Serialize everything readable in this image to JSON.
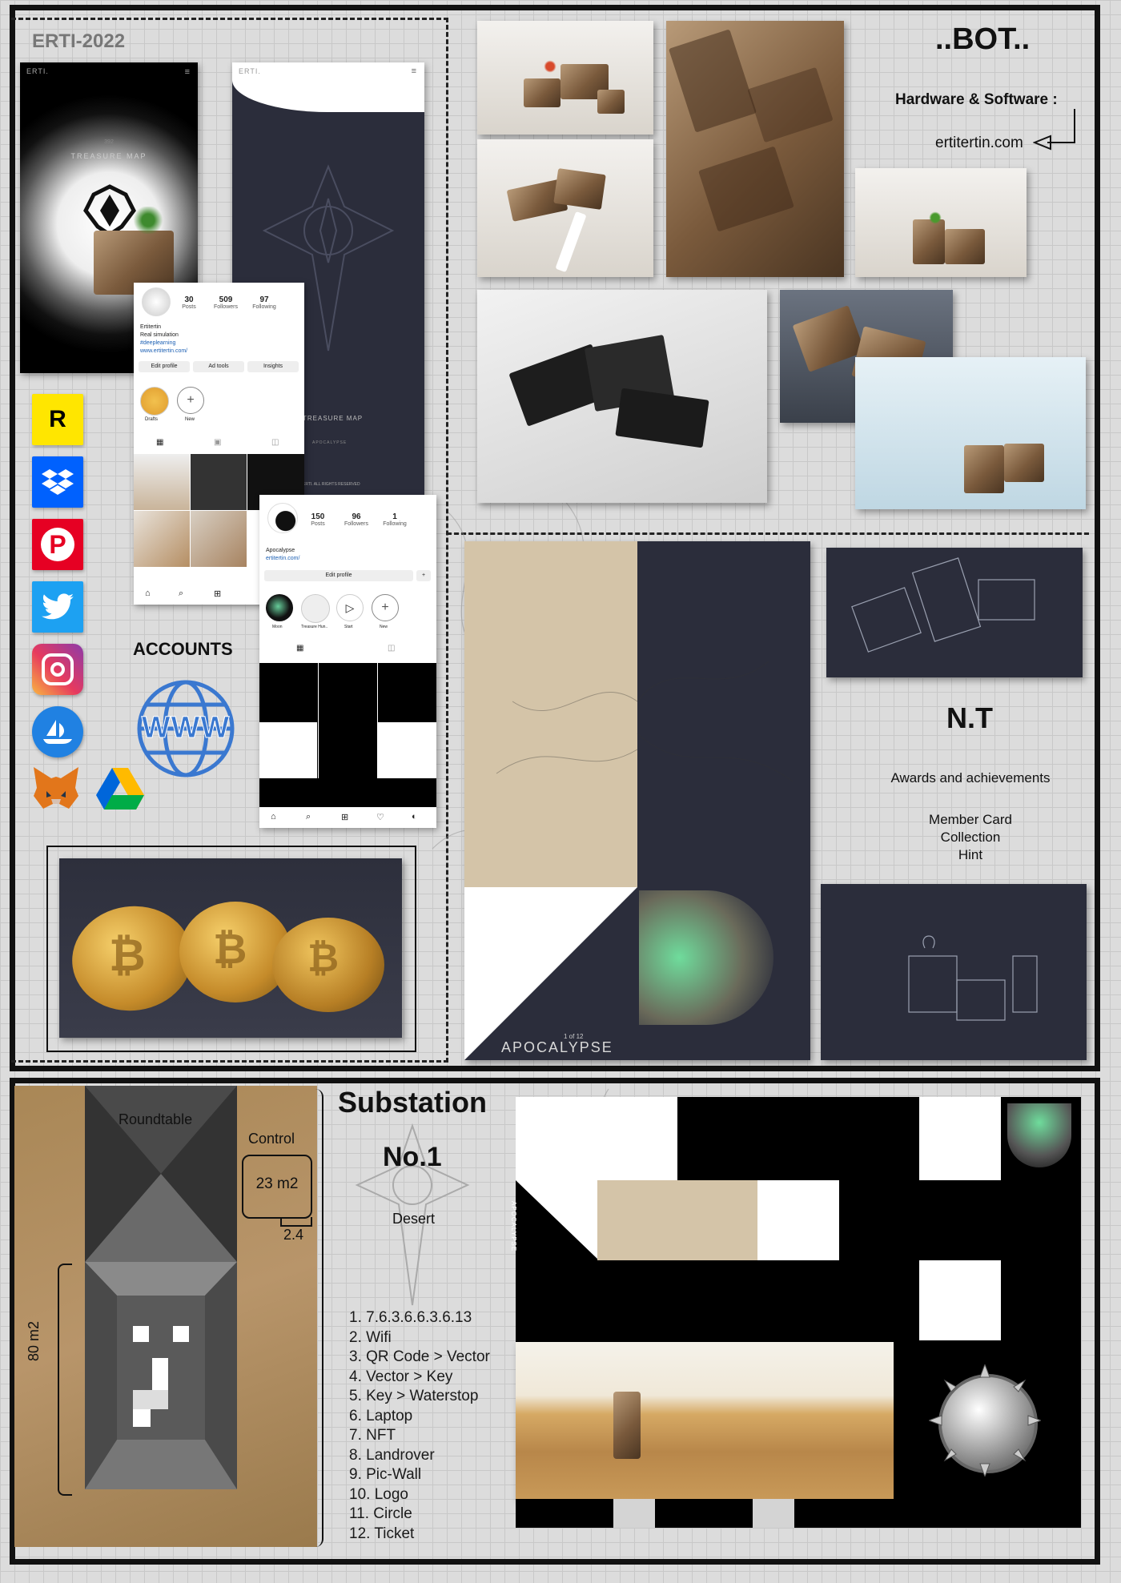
{
  "header": {
    "title": "ERTI-2022"
  },
  "bot": {
    "title": "..BOT..",
    "subtitle": "Hardware & Software :",
    "website": "ertitertin.com"
  },
  "phone1": {
    "brand": "ERTI.",
    "number": "392",
    "caption": "TREASURE MAP"
  },
  "phone2": {
    "brand": "ERTI.",
    "caption": "TREASURE MAP",
    "sub": "APOCALYPSE",
    "footer": "ERTI. ALL RIGHTS RESERVED"
  },
  "profile1": {
    "posts": "30",
    "posts_label": "Posts",
    "followers": "509",
    "followers_label": "Followers",
    "following": "97",
    "following_label": "Following",
    "name": "Ertitertin",
    "bio": "Real simulation",
    "tag": "#deeplearning",
    "link": "www.ertitertin.com/",
    "btn1": "Edit profile",
    "btn2": "Ad tools",
    "btn3": "Insights",
    "highlight1": "Drafts",
    "highlight2": "New"
  },
  "profile2": {
    "posts": "150",
    "posts_label": "Posts",
    "followers": "96",
    "followers_label": "Followers",
    "following": "1",
    "following_label": "Following",
    "name": "Apocalypse",
    "link": "ertitertin.com/",
    "btn": "Edit profile",
    "h1": "Moon",
    "h2": "Treasure Hun..",
    "h3": "Start",
    "h4": "New"
  },
  "accounts": {
    "label": "ACCOUNTS",
    "www": "WWW",
    "icons": [
      "rarible-icon",
      "dropbox-icon",
      "pinterest-icon",
      "twitter-icon",
      "instagram-icon",
      "opensea-icon",
      "metamask-icon",
      "google-drive-icon"
    ]
  },
  "nt": {
    "title": "N.T",
    "awards": "Awards and achievements",
    "line1": "Member Card",
    "line2": "Collection",
    "line3": "Hint"
  },
  "poster": {
    "title": "APOCALYPSE",
    "issue": "1 of 12"
  },
  "floorplan": {
    "roundtable": "Roundtable",
    "control": "Control",
    "area": "23 m2",
    "width": "2.4",
    "side": "80 m2"
  },
  "substation": {
    "title": "Substation",
    "number": "No.1",
    "place": "Desert",
    "items": [
      "1. 7.6.3.6.6.3.6.13",
      "2. Wifi",
      "3. QR Code > Vector",
      "4. Vector > Key",
      "5. Key > Waterstop",
      "6. Laptop",
      "7. NFT",
      "8. Landrover",
      "9. Pic-Wall",
      "10. Logo",
      "11. Circle",
      "12. Ticket"
    ],
    "vertical_label": "APOCALYPSE"
  },
  "colors": {
    "dark": "#2b2d3b",
    "beige": "#d4c4a8",
    "sand": "#b0895c"
  }
}
